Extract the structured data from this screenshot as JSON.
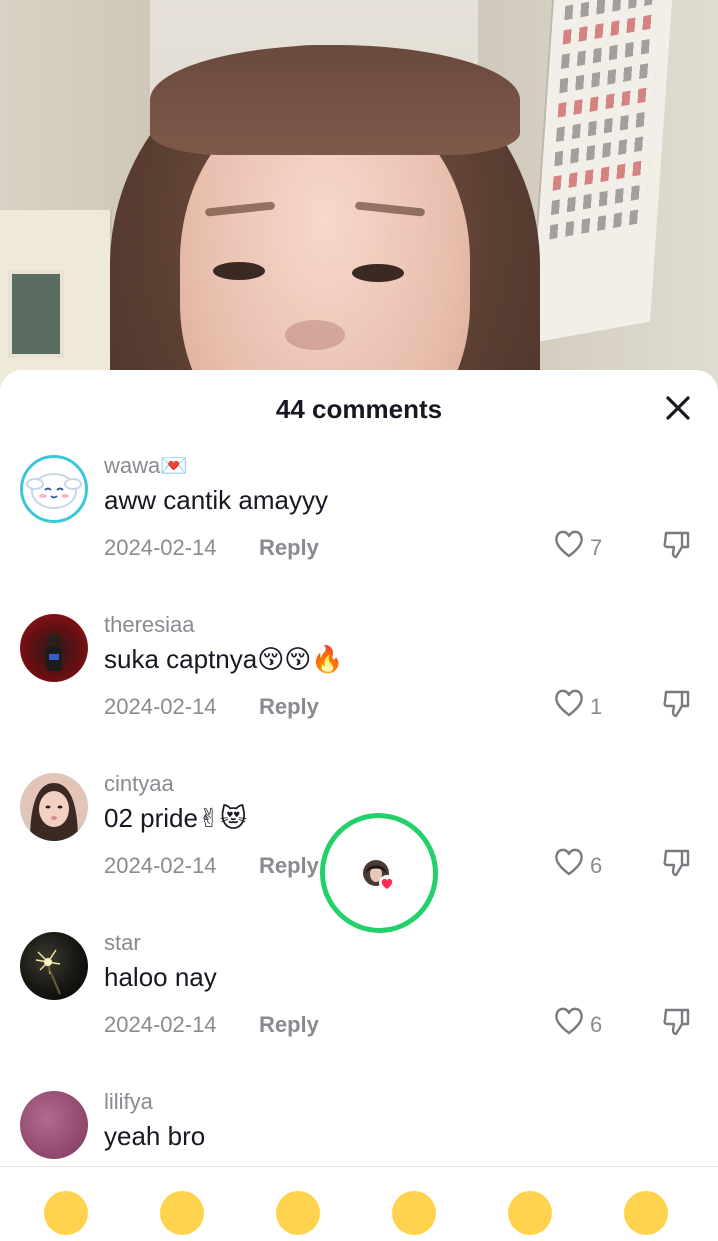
{
  "sheet": {
    "title": "44 comments"
  },
  "comments": [
    {
      "username": "wawa💌",
      "text": "aww cantik amayyy",
      "date": "2024-02-14",
      "reply_label": "Reply",
      "likes": "7",
      "avatar": "cinnamoroll-avatar"
    },
    {
      "username": "theresiaa",
      "text": "suka captnya😚😚🔥",
      "date": "2024-02-14",
      "reply_label": "Reply",
      "likes": "1",
      "avatar": "stage-photo-avatar"
    },
    {
      "username": "cintyaa",
      "text": "02 pride✌😻",
      "date": "2024-02-14",
      "reply_label": "Reply",
      "likes": "6",
      "avatar": "selfie-avatar",
      "creator_liked": true
    },
    {
      "username": "star",
      "text": "haloo nay",
      "date": "2024-02-14",
      "reply_label": "Reply",
      "likes": "6",
      "avatar": "sparkler-avatar"
    },
    {
      "username": "lilifya",
      "text": "yeah bro",
      "avatar": "plain-purple-avatar"
    }
  ],
  "colors": {
    "text_primary": "#161823",
    "text_secondary": "#8a8b91",
    "annotation_circle": "#23d16a",
    "creator_heart": "#fe2c55"
  },
  "icons": {
    "close": "close-icon",
    "like": "heart-outline-icon",
    "dislike": "thumbs-down-icon"
  }
}
